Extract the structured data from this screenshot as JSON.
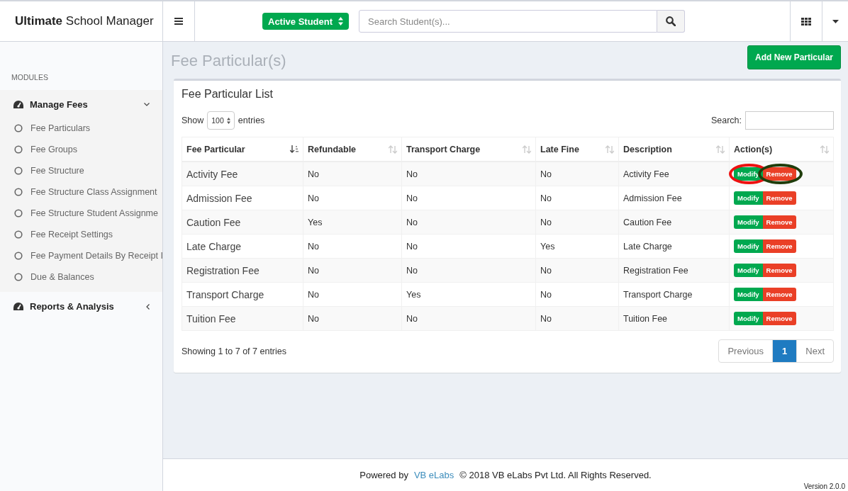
{
  "brand": {
    "bold": "Ultimate",
    "rest": "School Manager"
  },
  "header": {
    "student_filter": "Active Student",
    "search": {
      "placeholder": "Search Student(s)..."
    }
  },
  "sidebar": {
    "heading": "MODULES",
    "groups": [
      {
        "label": "Manage Fees",
        "expanded": true,
        "items": [
          "Fee Particulars",
          "Fee Groups",
          "Fee Structure",
          "Fee Structure Class Assignment",
          "Fee Structure Student Assignme",
          "Fee Receipt Settings",
          "Fee Payment Details By Receipt I",
          "Due & Balances"
        ]
      },
      {
        "label": "Reports & Analysis",
        "expanded": false
      }
    ]
  },
  "page": {
    "title": "Fee Particular(s)",
    "add_button": "Add New Particular"
  },
  "card": {
    "title": "Fee Particular List",
    "length": {
      "before": "Show",
      "value": "100",
      "after": "entries"
    },
    "search_label": "Search:",
    "table": {
      "columns": [
        {
          "label": "Fee Particular",
          "sorted": true
        },
        {
          "label": "Refundable",
          "sorted": false
        },
        {
          "label": "Transport Charge",
          "sorted": false
        },
        {
          "label": "Late Fine",
          "sorted": false
        },
        {
          "label": "Description",
          "sorted": false
        },
        {
          "label": "Action(s)",
          "sorted": false
        }
      ],
      "rows": [
        {
          "cells": [
            "Activity Fee",
            "No",
            "No",
            "No",
            "Activity Fee"
          ],
          "actions": [
            {
              "kind": "modify",
              "label": "Modify",
              "circle": {
                "color": "#ee1111"
              }
            },
            {
              "kind": "remove",
              "label": "Remove",
              "circle": {
                "color": "#1f3d0c"
              }
            }
          ]
        },
        {
          "cells": [
            "Admission Fee",
            "No",
            "No",
            "No",
            "Admission Fee"
          ],
          "actions": [
            {
              "kind": "modify",
              "label": "Modify"
            },
            {
              "kind": "remove",
              "label": "Remove"
            }
          ]
        },
        {
          "cells": [
            "Caution Fee",
            "Yes",
            "No",
            "No",
            "Caution Fee"
          ],
          "actions": [
            {
              "kind": "modify",
              "label": "Modify"
            },
            {
              "kind": "remove",
              "label": "Remove"
            }
          ]
        },
        {
          "cells": [
            "Late Charge",
            "No",
            "No",
            "Yes",
            "Late Charge"
          ],
          "actions": [
            {
              "kind": "modify",
              "label": "Modify"
            },
            {
              "kind": "remove",
              "label": "Remove"
            }
          ]
        },
        {
          "cells": [
            "Registration Fee",
            "No",
            "No",
            "No",
            "Registration Fee"
          ],
          "actions": [
            {
              "kind": "modify",
              "label": "Modify"
            },
            {
              "kind": "remove",
              "label": "Remove"
            }
          ]
        },
        {
          "cells": [
            "Transport Charge",
            "No",
            "Yes",
            "No",
            "Transport Charge"
          ],
          "actions": [
            {
              "kind": "modify",
              "label": "Modify"
            },
            {
              "kind": "remove",
              "label": "Remove"
            }
          ]
        },
        {
          "cells": [
            "Tuition Fee",
            "No",
            "No",
            "No",
            "Tuition Fee"
          ],
          "actions": [
            {
              "kind": "modify",
              "label": "Modify"
            },
            {
              "kind": "remove",
              "label": "Remove"
            }
          ]
        }
      ]
    },
    "info": "Showing 1 to 7 of 7 entries",
    "pagination": [
      {
        "label": "Previous",
        "selected": false
      },
      {
        "label": "1",
        "selected": true
      },
      {
        "label": "Next",
        "selected": false
      }
    ]
  },
  "footer": {
    "before": "Powered by",
    "link": "VB eLabs",
    "after": "© 2018 VB eLabs Pvt Ltd. All Rights Reserved.",
    "version": "Version 2.0.0"
  }
}
